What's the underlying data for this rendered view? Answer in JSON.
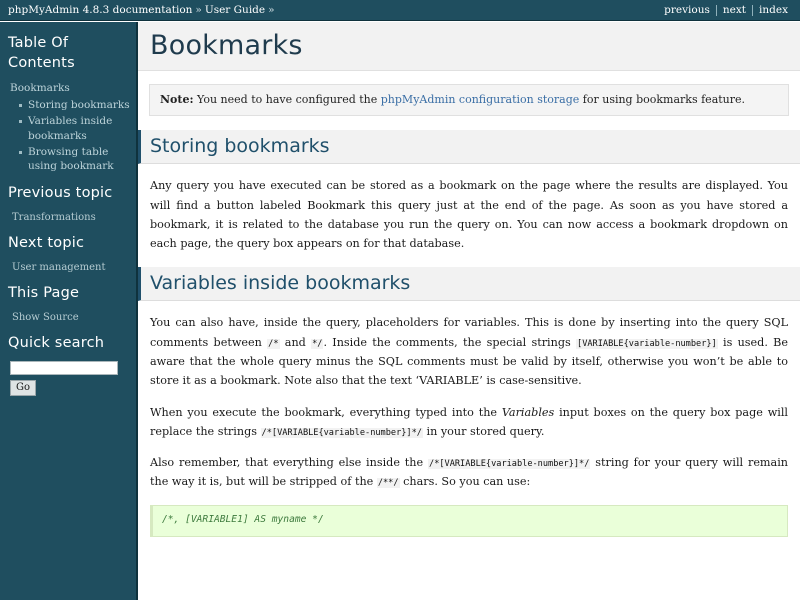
{
  "topbar": {
    "breadcrumb_root": "phpMyAdmin 4.8.3 documentation",
    "sep1": "»",
    "breadcrumb_section": "User Guide",
    "sep2": "»",
    "nav": {
      "previous": "previous",
      "next": "next",
      "index": "index"
    }
  },
  "sidebar": {
    "toc_title": "Table Of Contents",
    "toc_root_label": "Bookmarks",
    "toc_items": [
      "Storing bookmarks",
      "Variables inside bookmarks",
      "Browsing table using bookmark"
    ],
    "previous_topic_title": "Previous topic",
    "previous_topic_link": "Transformations",
    "next_topic_title": "Next topic",
    "next_topic_link": "User management",
    "this_page_title": "This Page",
    "show_source_link": "Show Source",
    "quick_search_title": "Quick search",
    "search_value": "",
    "search_placeholder": "",
    "search_button": "Go"
  },
  "main": {
    "page_title": "Bookmarks",
    "note": {
      "label": "Note:",
      "text_before": "You need to have configured the",
      "link": "phpMyAdmin configuration storage",
      "text_after": "for using bookmarks feature."
    },
    "sections": [
      {
        "heading": "Storing bookmarks",
        "paragraph": "Any query you have executed can be stored as a bookmark on the page where the results are displayed. You will find a button labeled Bookmark this query just at the end of the page. As soon as you have stored a bookmark, it is related to the database you run the query on. You can now access a bookmark dropdown on each page, the query box appears on for that database."
      },
      {
        "heading": "Variables inside bookmarks",
        "p1_a": "You can also have, inside the query, placeholders for variables. This is done by inserting into the query SQL comments between",
        "p1_code1": "/*",
        "p1_b": "and",
        "p1_code2": "*/",
        "p1_c": ". Inside the comments, the special strings",
        "p1_code3": "[VARIABLE{variable-number}]",
        "p1_d": "is used. Be aware that the whole query minus the SQL comments must be valid by itself, otherwise you won’t be able to store it as a bookmark. Note also that the text",
        "p1_quoted": "‘VARIABLE’",
        "p1_e": "is case-sensitive.",
        "p2_a": "When you execute the bookmark, everything typed into the",
        "p2_em": "Variables",
        "p2_b": "input boxes on the query box page will replace the strings",
        "p2_code": "/*[VARIABLE{variable-number}]*/",
        "p2_c": "in your stored query.",
        "p3_a": "Also remember, that everything else inside the",
        "p3_code1": "/*[VARIABLE{variable-number}]*/",
        "p3_b": "string for your query will remain the way it is, but will be stripped of the",
        "p3_code2": "/**/",
        "p3_c": "chars. So you can use:",
        "code_block": "/*, [VARIABLE1] AS myname */"
      }
    ]
  },
  "colors": {
    "sidebar_bg": "#1f4e5f",
    "heading_text": "#20506b",
    "link": "#3a6ea5",
    "code_block_bg": "#eaffd9",
    "code_block_text": "#3d7a3d"
  }
}
